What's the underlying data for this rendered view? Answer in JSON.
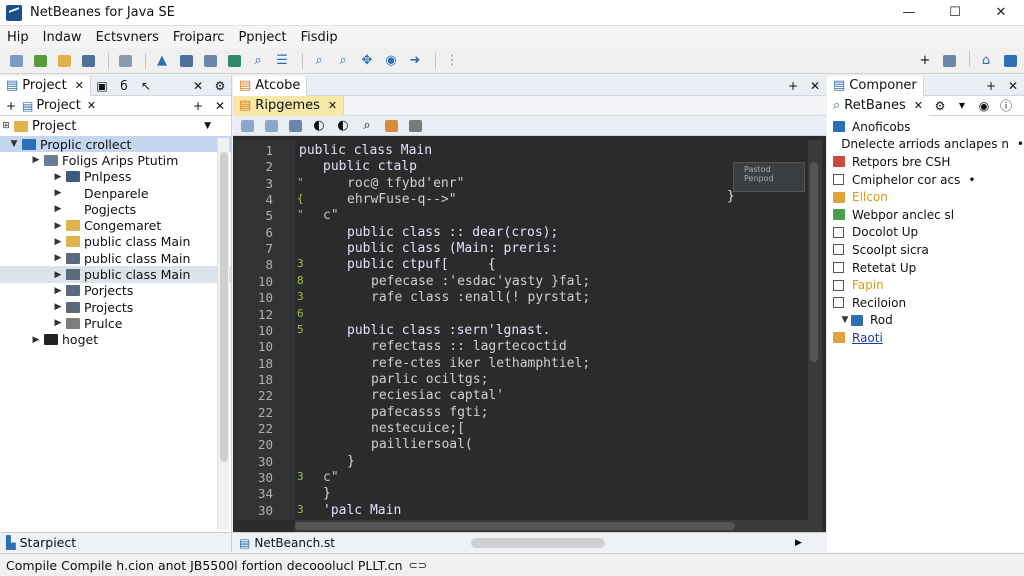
{
  "window": {
    "title": "NetBeanes for Java SE",
    "minimize": "—",
    "maximize": "☐",
    "close": "✕"
  },
  "menu": [
    "Hip",
    "Indaw",
    "Ectsvners",
    "Froiparc",
    "Ppnject",
    "Fisdip"
  ],
  "left": {
    "tab_label": "Project",
    "sub_label": "Project",
    "tree_header": "Project",
    "tree": [
      {
        "label": "Proplic crollect",
        "indent": 0,
        "twisty": "▼",
        "icon": "#2d6fb5",
        "hl": true
      },
      {
        "label": "Foligs Arips Ptutim",
        "indent": 1,
        "twisty": "▶",
        "icon": "#6a7d95"
      },
      {
        "label": "Pnlpess",
        "indent": 2,
        "twisty": "▶",
        "icon": "#3d5a80"
      },
      {
        "label": "Denparele",
        "indent": 2,
        "twisty": "▶",
        "icon": ""
      },
      {
        "label": "Pogjects",
        "indent": 2,
        "twisty": "▶",
        "icon": ""
      },
      {
        "label": "Congemaret",
        "indent": 2,
        "twisty": "▶",
        "icon": "#e0b34a"
      },
      {
        "label": "public class Main",
        "indent": 2,
        "twisty": "▶",
        "icon": "#e0b34a"
      },
      {
        "label": "public class Main",
        "indent": 2,
        "twisty": "▶",
        "icon": "#5a6a7a"
      },
      {
        "label": "public class Main",
        "indent": 2,
        "twisty": "▶",
        "icon": "#5a6a7a",
        "sel": true
      },
      {
        "label": "Porjects",
        "indent": 2,
        "twisty": "▶",
        "icon": "#5a6a7a"
      },
      {
        "label": "Projects",
        "indent": 2,
        "twisty": "▶",
        "icon": "#5a6a7a"
      },
      {
        "label": "Prulce",
        "indent": 2,
        "twisty": "▶",
        "icon": "#7d7d7d"
      },
      {
        "label": "hoget",
        "indent": 1,
        "twisty": "▶",
        "icon": "#222222"
      }
    ],
    "bottom_tab": "Starpiect"
  },
  "editor": {
    "tab_label": "Atcobe",
    "sub_tab": "Ripgemes",
    "bottom_tab": "NetBeanch.st",
    "lines": [
      {
        "n": "1",
        "text": "public class Main",
        "indent": 0,
        "color": "#e2e2ff"
      },
      {
        "n": "2",
        "text": "public ctalp",
        "indent": 1,
        "color": "#e2e2ff"
      },
      {
        "n": "3",
        "text": "roc@ tfybd'enr\"",
        "indent": 2,
        "color": "#cfcfcf"
      },
      {
        "n": "4",
        "text": "ehrwFuse-q-->\"",
        "indent": 2,
        "color": "#cfcfcf"
      },
      {
        "n": "5",
        "text": "c\"",
        "indent": 1,
        "color": "#c0c0c0"
      },
      {
        "n": "6",
        "text": "public class :: dear(cros);",
        "indent": 2,
        "color": "#e2e2ff"
      },
      {
        "n": "7",
        "text": "public class (Main: preris:",
        "indent": 2,
        "color": "#e2e2ff"
      },
      {
        "n": "8",
        "text": "public ctpuf[     {",
        "indent": 2,
        "color": "#e2e2ff"
      },
      {
        "n": "10",
        "text": "pefecase :'esdac'yasty }fal;",
        "indent": 3,
        "color": "#cfcfcf"
      },
      {
        "n": "10",
        "text": "rafe class :enall(! pyrstat;",
        "indent": 3,
        "color": "#cfcfcf"
      },
      {
        "n": "12",
        "text": "",
        "indent": 0,
        "color": "#cfcfcf"
      },
      {
        "n": "10",
        "text": "public class :sern'lgnast.",
        "indent": 2,
        "color": "#e2e2ff"
      },
      {
        "n": "10",
        "text": "refectass :: lagrtecoctid",
        "indent": 3,
        "color": "#cfcfcf"
      },
      {
        "n": "18",
        "text": "refe-ctes iker lethamphtiel;",
        "indent": 3,
        "color": "#cfcfcf"
      },
      {
        "n": "18",
        "text": "parlic ociltgs;",
        "indent": 3,
        "color": "#cfcfcf"
      },
      {
        "n": "22",
        "text": "reciesiac captal'",
        "indent": 3,
        "color": "#cfcfcf"
      },
      {
        "n": "22",
        "text": "pafecasss fgti;",
        "indent": 3,
        "color": "#cfcfcf"
      },
      {
        "n": "22",
        "text": "nestecuice;[",
        "indent": 3,
        "color": "#cfcfcf"
      },
      {
        "n": "20",
        "text": "pailliersoal(",
        "indent": 3,
        "color": "#cfcfcf"
      },
      {
        "n": "30",
        "text": "}",
        "indent": 2,
        "color": "#dcdcdc"
      },
      {
        "n": "30",
        "text": "c\"",
        "indent": 1,
        "color": "#c0c0c0"
      },
      {
        "n": "34",
        "text": "}",
        "indent": 1,
        "color": "#dcdcdc"
      },
      {
        "n": "30",
        "text": "'palc Main",
        "indent": 1,
        "color": "#e2e2ff"
      }
    ],
    "gutter_marks": [
      {
        "row": 2,
        "text": "\""
      },
      {
        "row": 3,
        "text": "{"
      },
      {
        "row": 4,
        "text": "\""
      },
      {
        "row": 7,
        "text": "3"
      },
      {
        "row": 8,
        "text": "8"
      },
      {
        "row": 9,
        "text": "3"
      },
      {
        "row": 10,
        "text": "6"
      },
      {
        "row": 11,
        "text": "5"
      },
      {
        "row": 20,
        "text": "3"
      },
      {
        "row": 22,
        "text": "3"
      }
    ],
    "hints": [
      "Pastod",
      "Penpod"
    ]
  },
  "right": {
    "tab_label": "Componer",
    "sub_tab": "RetBanes",
    "items": [
      {
        "label": "Anoficobs",
        "kind": "folder",
        "color": "#2d6fb5"
      },
      {
        "label": "Dnelecte arriods anclapes n",
        "kind": "plain"
      },
      {
        "label": "Retpors bre CSH",
        "kind": "icon",
        "color": "#c94c3a"
      },
      {
        "label": "Cmiphelor cor acs",
        "kind": "check"
      },
      {
        "label": "Ellcon",
        "kind": "icon",
        "color": "#e0a23a",
        "textcolor": "#d99a1a"
      },
      {
        "label": "Webpor anclec sl",
        "kind": "icon",
        "color": "#4aa04a"
      },
      {
        "label": "Docolot Up",
        "kind": "check"
      },
      {
        "label": "Scoolpt sicra",
        "kind": "check"
      },
      {
        "label": "Retetat Up",
        "kind": "check"
      },
      {
        "label": "Fapin",
        "kind": "check",
        "textcolor": "#d99a1a"
      },
      {
        "label": "Reciloion",
        "kind": "check"
      },
      {
        "label": "Rod",
        "kind": "subfolder",
        "color": "#2d6fb5"
      },
      {
        "label": "Raoti",
        "kind": "link",
        "color": "#e0a23a",
        "textcolor": "#1a3fa0"
      }
    ]
  },
  "status": {
    "text": "Compile Compile h.cion anot JB5500l fortion decooolucl PLLT.cn"
  }
}
